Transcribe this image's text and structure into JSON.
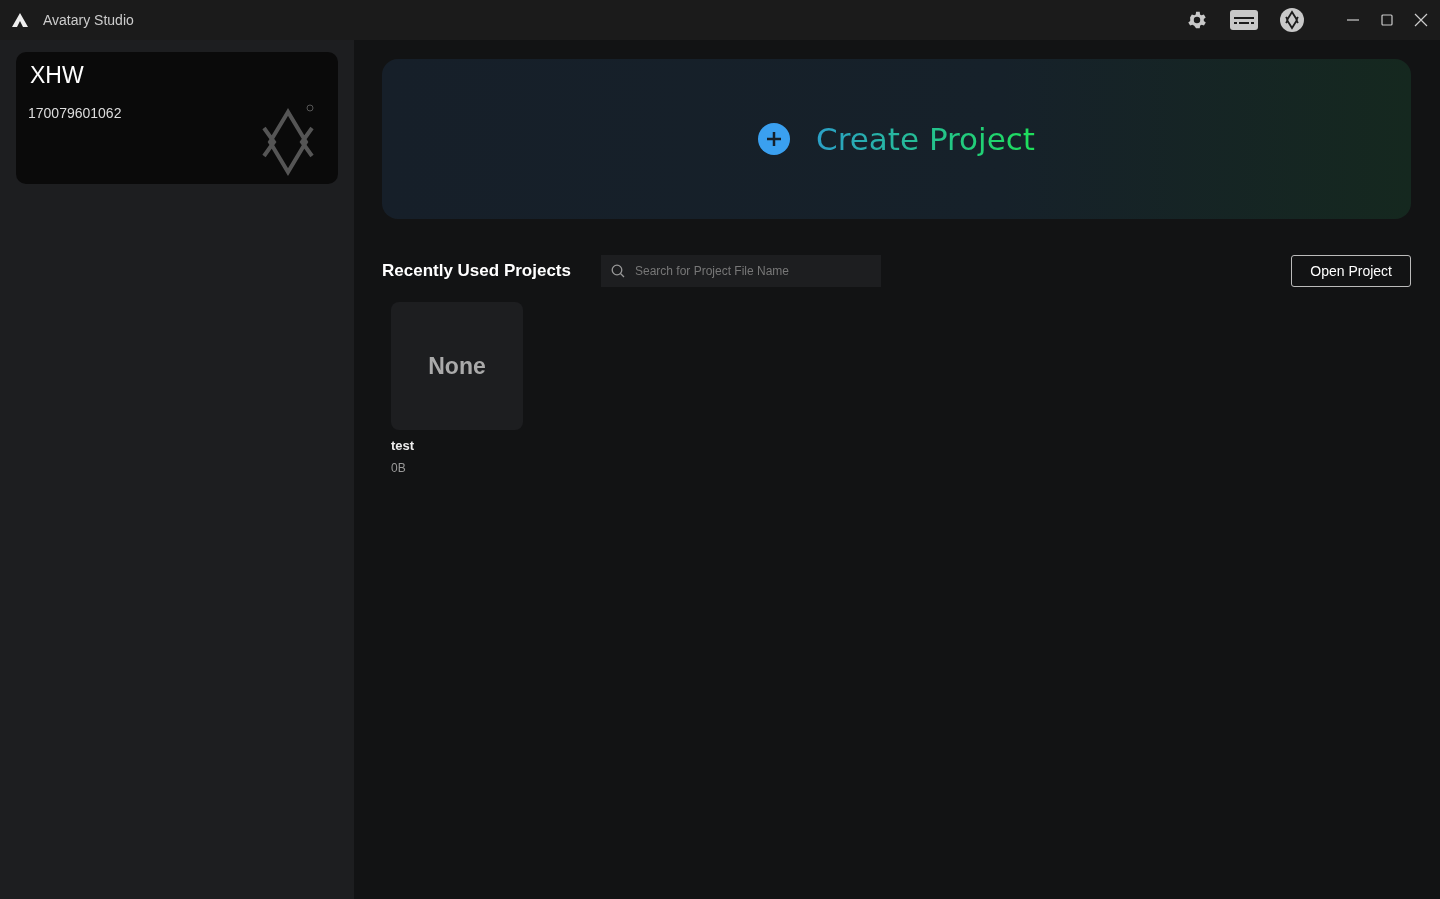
{
  "window": {
    "title": "Avatary Studio"
  },
  "account": {
    "name": "XHW",
    "id": "170079601062"
  },
  "create": {
    "label": "Create Project"
  },
  "recent": {
    "title": "Recently Used Projects",
    "search": {
      "placeholder": "Search for Project File Name"
    },
    "open_button": "Open Project",
    "projects": [
      {
        "thumbnail": "None",
        "name": "test",
        "size": "0B"
      }
    ]
  }
}
